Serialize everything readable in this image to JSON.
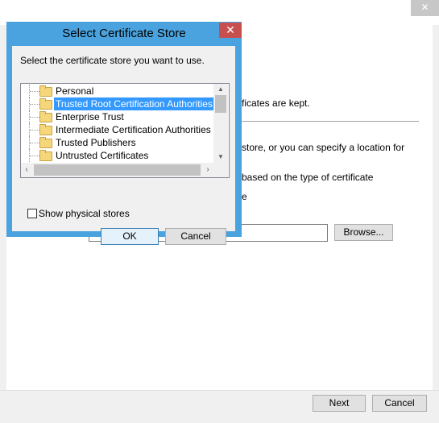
{
  "wizard": {
    "close_glyph": "✕",
    "text_line1": "ficates are kept.",
    "text_line2": "store, or you can specify a location for",
    "text_line3": "based on the type of certificate",
    "text_line4": "e",
    "browse_label": "Browse...",
    "next_label": "Next",
    "cancel_label": "Cancel"
  },
  "dialog": {
    "title": "Select Certificate Store",
    "close_glyph": "✕",
    "instruction": "Select the certificate store you want to use.",
    "tree_items": [
      {
        "label": "Personal",
        "selected": false
      },
      {
        "label": "Trusted Root Certification Authorities",
        "selected": true
      },
      {
        "label": "Enterprise Trust",
        "selected": false
      },
      {
        "label": "Intermediate Certification Authorities",
        "selected": false
      },
      {
        "label": "Trusted Publishers",
        "selected": false
      },
      {
        "label": "Untrusted Certificates",
        "selected": false
      }
    ],
    "show_physical_label": "Show physical stores",
    "show_physical_checked": false,
    "ok_label": "OK",
    "cancel_label": "Cancel"
  },
  "colors": {
    "dialog_frame": "#4aa3df",
    "selection": "#3399ff",
    "close_button": "#c7504f"
  }
}
